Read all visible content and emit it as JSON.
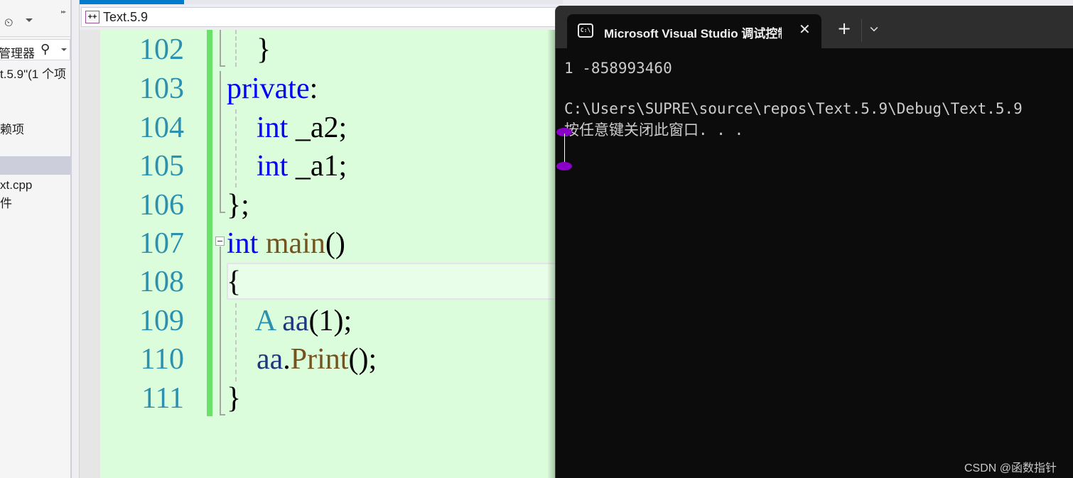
{
  "sidebar": {
    "search_placeholder": "管理器",
    "items": [
      {
        "label": "t.5.9\"(1 个项",
        "selected": false
      },
      {
        "label": "赖项",
        "selected": false
      },
      {
        "label": "",
        "selected": false
      },
      {
        "label": "",
        "selected": true
      },
      {
        "label": "xt.cpp",
        "selected": false
      },
      {
        "label": "件",
        "selected": false
      }
    ]
  },
  "editor": {
    "nav_project": "Text.5.9",
    "lines": [
      {
        "num": "102",
        "tokens": [
          {
            "t": "    }",
            "c": ""
          }
        ]
      },
      {
        "num": "103",
        "tokens": [
          {
            "t": "private",
            "c": "kw"
          },
          {
            "t": ":",
            "c": ""
          }
        ]
      },
      {
        "num": "104",
        "tokens": [
          {
            "t": "    ",
            "c": ""
          },
          {
            "t": "int",
            "c": "kw"
          },
          {
            "t": " _a2;",
            "c": ""
          }
        ]
      },
      {
        "num": "105",
        "tokens": [
          {
            "t": "    ",
            "c": ""
          },
          {
            "t": "int",
            "c": "kw"
          },
          {
            "t": " _a1;",
            "c": ""
          }
        ]
      },
      {
        "num": "106",
        "tokens": [
          {
            "t": "};",
            "c": ""
          }
        ]
      },
      {
        "num": "107",
        "tokens": [
          {
            "t": "int",
            "c": "kw"
          },
          {
            "t": " ",
            "c": ""
          },
          {
            "t": "main",
            "c": "fn"
          },
          {
            "t": "()",
            "c": ""
          }
        ]
      },
      {
        "num": "108",
        "tokens": [
          {
            "t": "{",
            "c": ""
          }
        ]
      },
      {
        "num": "109",
        "tokens": [
          {
            "t": "    ",
            "c": ""
          },
          {
            "t": "A",
            "c": "ty"
          },
          {
            "t": " ",
            "c": ""
          },
          {
            "t": "aa",
            "c": "var"
          },
          {
            "t": "(1);",
            "c": ""
          }
        ]
      },
      {
        "num": "110",
        "tokens": [
          {
            "t": "    ",
            "c": ""
          },
          {
            "t": "aa",
            "c": "var"
          },
          {
            "t": ".",
            "c": ""
          },
          {
            "t": "Print",
            "c": "fn"
          },
          {
            "t": "();",
            "c": ""
          }
        ]
      },
      {
        "num": "111",
        "tokens": [
          {
            "t": "}",
            "c": ""
          }
        ]
      }
    ]
  },
  "terminal": {
    "tab_title": "Microsoft Visual Studio 调试控制台",
    "output_lines": [
      "1 -858993460",
      "",
      "C:\\Users\\SUPRE\\source\\repos\\Text.5.9\\Debug\\Text.5.9",
      "按任意键关闭此窗口. . ."
    ]
  },
  "watermark": "CSDN @函数指针"
}
